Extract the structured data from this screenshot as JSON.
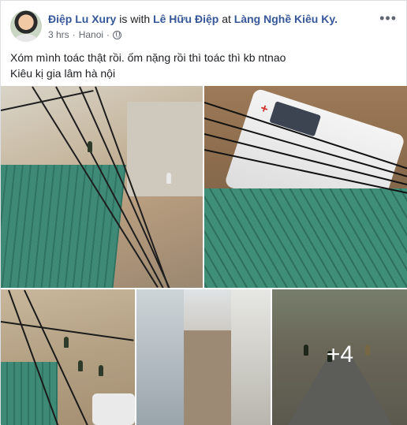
{
  "post": {
    "author": "Điệp Lu Xury",
    "with_text": " is with ",
    "tagged": "Lê Hữu Điệp",
    "at_text": " at ",
    "place": "Làng Nghề Kiêu Ky.",
    "time": "3 hrs",
    "location": "Hanoi",
    "privacy_icon": "globe-icon",
    "more_label": "•••",
    "text_lines": [
      "Xóm mình toác thật rồi. ốm nặng rồi thì toác thì kb ntnao",
      "Kiêu kị gia lâm hà nội"
    ],
    "more_photos": "+4"
  },
  "colors": {
    "link": "#365899",
    "meta": "#616770",
    "text": "#1c1e21"
  }
}
